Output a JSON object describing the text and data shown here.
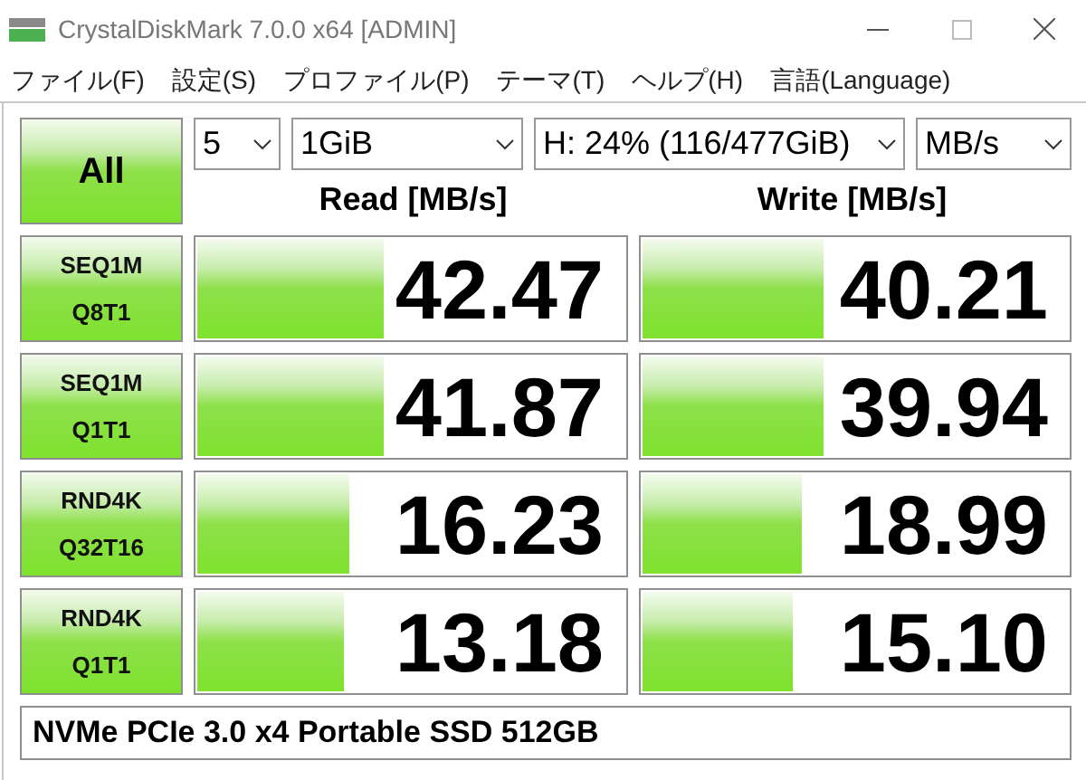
{
  "window": {
    "title": "CrystalDiskMark 7.0.0 x64 [ADMIN]"
  },
  "menu": [
    "ファイル(F)",
    "設定(S)",
    "プロファイル(P)",
    "テーマ(T)",
    "ヘルプ(H)",
    "言語(Language)"
  ],
  "all_button": "All",
  "selects": [
    {
      "value": "5"
    },
    {
      "value": "1GiB"
    },
    {
      "value": "H: 24% (116/477GiB)"
    },
    {
      "value": "MB/s"
    }
  ],
  "headers": [
    "Read [MB/s]",
    "Write [MB/s]"
  ],
  "rows": [
    {
      "label": [
        "SEQ1M",
        "Q8T1"
      ],
      "read": {
        "value": "42.47",
        "level": 0.44
      },
      "write": {
        "value": "40.21",
        "level": 0.43
      }
    },
    {
      "label": [
        "SEQ1M",
        "Q1T1"
      ],
      "read": {
        "value": "41.87",
        "level": 0.44
      },
      "write": {
        "value": "39.94",
        "level": 0.43
      }
    },
    {
      "label": [
        "RND4K",
        "Q32T16"
      ],
      "read": {
        "value": "16.23",
        "level": 0.36
      },
      "write": {
        "value": "18.99",
        "level": 0.38
      }
    },
    {
      "label": [
        "RND4K",
        "Q1T1"
      ],
      "read": {
        "value": "13.18",
        "level": 0.35
      },
      "write": {
        "value": "15.10",
        "level": 0.36
      }
    }
  ],
  "comment": "NVMe PCIe 3.0 x4 Portable SSD 512GB"
}
